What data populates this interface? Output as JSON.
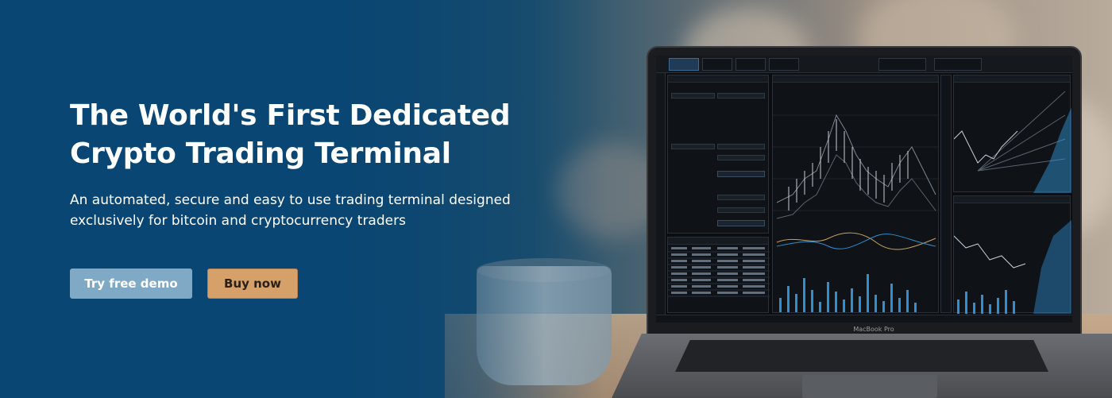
{
  "hero": {
    "title": "The World's First Dedicated Crypto Trading Terminal",
    "subtitle": "An automated, secure and easy to use trading terminal designed exclusively for bitcoin and cryptocurrency traders",
    "buttons": {
      "demo_label": "Try free demo",
      "buy_label": "Buy now"
    }
  },
  "laptop": {
    "model_label": "MacBook Pro"
  },
  "colors": {
    "background_blue": "#0b4b76",
    "demo_button": "#7fa9c4",
    "buy_button": "#d6a06b",
    "chart_line": "#2f8fd0"
  },
  "icons": {
    "laptop": "laptop-icon",
    "cup": "coffee-cup-icon"
  }
}
